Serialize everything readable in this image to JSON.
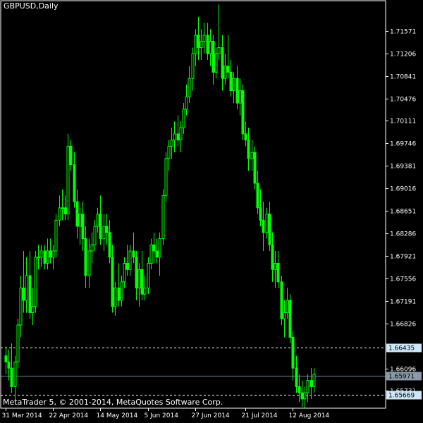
{
  "window": {
    "title": "GBPUSD,Daily",
    "copyright": "MetaTrader 5, © 2001-2014, MetaQuotes Software Corp."
  },
  "colors": {
    "background": "#000000",
    "candle": "#00ff00",
    "frame": "#ffffff",
    "guide": "#ffffff",
    "bid_line": "#778899",
    "tag_bg": "#cfe8f8",
    "bid_tag_bg": "#8a9aa8"
  },
  "chart_data": {
    "type": "candlestick",
    "symbol": "GBPUSD",
    "timeframe": "Daily",
    "ylim": [
      1.6545,
      1.7206
    ],
    "x_tick_labels": [
      "31 Mar 2014",
      "22 Apr 2014",
      "14 May 2014",
      "5 Jun 2014",
      "27 Jun 2014",
      "21 Jul 2014",
      "12 Aug 2014"
    ],
    "x_tick_positions": [
      0,
      16,
      32,
      48,
      64,
      81,
      97
    ],
    "y_ticks": [
      "1.71571",
      "1.71206",
      "1.70841",
      "1.70476",
      "1.70111",
      "1.69746",
      "1.69381",
      "1.69016",
      "1.68651",
      "1.68286",
      "1.67921",
      "1.67556",
      "1.67191",
      "1.66826",
      "1.66435",
      "1.66096",
      "1.65971",
      "1.65731",
      "1.65669"
    ],
    "horizontal_levels": [
      {
        "value": 1.66435,
        "label": "1.66435",
        "style": "dashed"
      },
      {
        "value": 1.65971,
        "label": "1.65971",
        "style": "bid"
      },
      {
        "value": 1.65669,
        "label": "1.65669",
        "style": "dashed"
      }
    ],
    "candles": [
      [
        1.663,
        1.6645,
        1.66,
        1.662
      ],
      [
        1.662,
        1.664,
        1.659,
        1.661
      ],
      [
        1.661,
        1.665,
        1.657,
        1.658
      ],
      [
        1.658,
        1.663,
        1.6555,
        1.662
      ],
      [
        1.662,
        1.669,
        1.661,
        1.668
      ],
      [
        1.668,
        1.676,
        1.666,
        1.674
      ],
      [
        1.674,
        1.68,
        1.67,
        1.672
      ],
      [
        1.672,
        1.679,
        1.67,
        1.676
      ],
      [
        1.676,
        1.68,
        1.669,
        1.67
      ],
      [
        1.67,
        1.674,
        1.668,
        1.671
      ],
      [
        1.671,
        1.68,
        1.67,
        1.679
      ],
      [
        1.679,
        1.681,
        1.677,
        1.679
      ],
      [
        1.679,
        1.681,
        1.6775,
        1.68
      ],
      [
        1.68,
        1.681,
        1.677,
        1.678
      ],
      [
        1.678,
        1.682,
        1.677,
        1.68
      ],
      [
        1.68,
        1.682,
        1.678,
        1.679
      ],
      [
        1.679,
        1.681,
        1.677,
        1.68
      ],
      [
        1.68,
        1.686,
        1.679,
        1.685
      ],
      [
        1.685,
        1.689,
        1.684,
        1.687
      ],
      [
        1.687,
        1.69,
        1.685,
        1.687
      ],
      [
        1.687,
        1.689,
        1.685,
        1.686
      ],
      [
        1.686,
        1.699,
        1.685,
        1.697
      ],
      [
        1.697,
        1.698,
        1.693,
        1.694
      ],
      [
        1.694,
        1.696,
        1.687,
        1.688
      ],
      [
        1.688,
        1.69,
        1.682,
        1.684
      ],
      [
        1.684,
        1.687,
        1.681,
        1.686
      ],
      [
        1.686,
        1.688,
        1.68,
        1.682
      ],
      [
        1.682,
        1.684,
        1.674,
        1.676
      ],
      [
        1.676,
        1.682,
        1.674,
        1.68
      ],
      [
        1.68,
        1.683,
        1.678,
        1.681
      ],
      [
        1.681,
        1.685,
        1.68,
        1.684
      ],
      [
        1.684,
        1.687,
        1.683,
        1.686
      ],
      [
        1.686,
        1.689,
        1.681,
        1.682
      ],
      [
        1.682,
        1.686,
        1.68,
        1.684
      ],
      [
        1.684,
        1.686,
        1.681,
        1.683
      ],
      [
        1.683,
        1.685,
        1.678,
        1.679
      ],
      [
        1.679,
        1.681,
        1.67,
        1.671
      ],
      [
        1.671,
        1.675,
        1.6695,
        1.674
      ],
      [
        1.674,
        1.678,
        1.671,
        1.672
      ],
      [
        1.672,
        1.676,
        1.671,
        1.675
      ],
      [
        1.675,
        1.679,
        1.674,
        1.678
      ],
      [
        1.678,
        1.681,
        1.676,
        1.677
      ],
      [
        1.677,
        1.681,
        1.676,
        1.68
      ],
      [
        1.68,
        1.683,
        1.678,
        1.679
      ],
      [
        1.679,
        1.68,
        1.672,
        1.674
      ],
      [
        1.674,
        1.678,
        1.671,
        1.677
      ],
      [
        1.677,
        1.68,
        1.672,
        1.673
      ],
      [
        1.673,
        1.676,
        1.672,
        1.674
      ],
      [
        1.674,
        1.679,
        1.673,
        1.678
      ],
      [
        1.678,
        1.682,
        1.677,
        1.681
      ],
      [
        1.681,
        1.683,
        1.678,
        1.68
      ],
      [
        1.68,
        1.682,
        1.678,
        1.679
      ],
      [
        1.679,
        1.683,
        1.676,
        1.682
      ],
      [
        1.682,
        1.69,
        1.681,
        1.689
      ],
      [
        1.689,
        1.696,
        1.688,
        1.695
      ],
      [
        1.695,
        1.698,
        1.693,
        1.697
      ],
      [
        1.697,
        1.7,
        1.695,
        1.698
      ],
      [
        1.698,
        1.701,
        1.696,
        1.699
      ],
      [
        1.699,
        1.702,
        1.697,
        1.698
      ],
      [
        1.698,
        1.701,
        1.696,
        1.7
      ],
      [
        1.7,
        1.704,
        1.699,
        1.703
      ],
      [
        1.703,
        1.707,
        1.702,
        1.705
      ],
      [
        1.705,
        1.71,
        1.704,
        1.708
      ],
      [
        1.708,
        1.713,
        1.706,
        1.712
      ],
      [
        1.712,
        1.716,
        1.71,
        1.715
      ],
      [
        1.715,
        1.718,
        1.711,
        1.713
      ],
      [
        1.713,
        1.716,
        1.711,
        1.714
      ],
      [
        1.714,
        1.717,
        1.712,
        1.715
      ],
      [
        1.715,
        1.717,
        1.711,
        1.712
      ],
      [
        1.712,
        1.716,
        1.71,
        1.714
      ],
      [
        1.714,
        1.715,
        1.707,
        1.709
      ],
      [
        1.709,
        1.713,
        1.708,
        1.712
      ],
      [
        1.712,
        1.72,
        1.711,
        1.713
      ],
      [
        1.713,
        1.715,
        1.706,
        1.708
      ],
      [
        1.708,
        1.712,
        1.707,
        1.71
      ],
      [
        1.71,
        1.715,
        1.708,
        1.709
      ],
      [
        1.709,
        1.711,
        1.705,
        1.706
      ],
      [
        1.706,
        1.709,
        1.704,
        1.708
      ],
      [
        1.708,
        1.71,
        1.703,
        1.704
      ],
      [
        1.704,
        1.708,
        1.702,
        1.706
      ],
      [
        1.706,
        1.707,
        1.698,
        1.699
      ],
      [
        1.699,
        1.701,
        1.697,
        1.698
      ],
      [
        1.698,
        1.7,
        1.693,
        1.695
      ],
      [
        1.695,
        1.698,
        1.693,
        1.696
      ],
      [
        1.696,
        1.697,
        1.69,
        1.691
      ],
      [
        1.691,
        1.693,
        1.686,
        1.687
      ],
      [
        1.687,
        1.69,
        1.684,
        1.685
      ],
      [
        1.685,
        1.688,
        1.68,
        1.683
      ],
      [
        1.683,
        1.687,
        1.682,
        1.686
      ],
      [
        1.686,
        1.688,
        1.68,
        1.681
      ],
      [
        1.681,
        1.683,
        1.675,
        1.677
      ],
      [
        1.677,
        1.68,
        1.674,
        1.678
      ],
      [
        1.678,
        1.68,
        1.674,
        1.675
      ],
      [
        1.675,
        1.676,
        1.668,
        1.669
      ],
      [
        1.669,
        1.672,
        1.666,
        1.67
      ],
      [
        1.67,
        1.674,
        1.669,
        1.672
      ],
      [
        1.672,
        1.673,
        1.665,
        1.666
      ],
      [
        1.666,
        1.667,
        1.659,
        1.661
      ],
      [
        1.661,
        1.663,
        1.657,
        1.658
      ],
      [
        1.658,
        1.66,
        1.6555,
        1.657
      ],
      [
        1.657,
        1.659,
        1.6547,
        1.656
      ],
      [
        1.656,
        1.658,
        1.6545,
        1.657
      ],
      [
        1.657,
        1.66,
        1.6555,
        1.659
      ],
      [
        1.659,
        1.661,
        1.656,
        1.658
      ],
      [
        1.658,
        1.661,
        1.657,
        1.66
      ]
    ]
  }
}
